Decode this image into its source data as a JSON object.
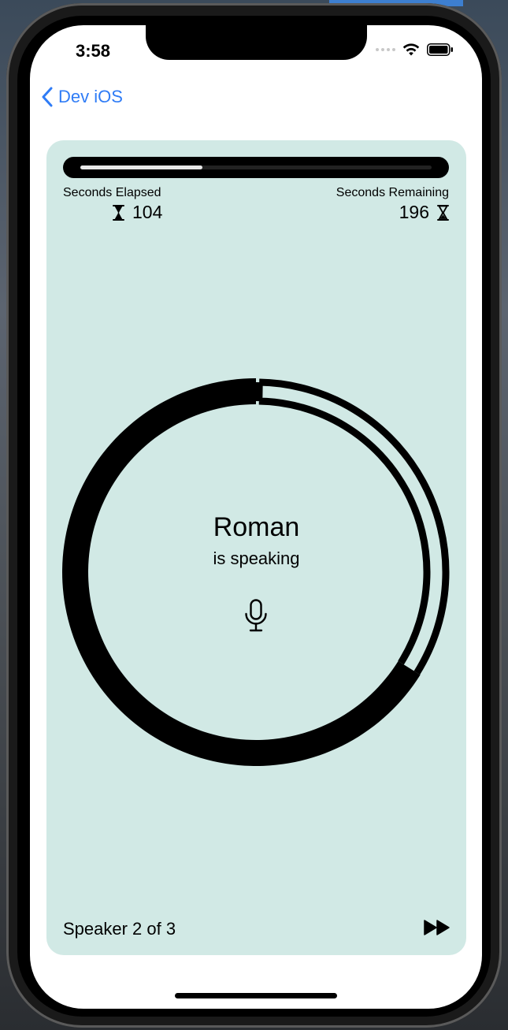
{
  "status_bar": {
    "time": "3:58",
    "icons": [
      "cellular-dots-icon",
      "wifi-icon",
      "battery-icon"
    ]
  },
  "nav": {
    "back_label": "Dev iOS",
    "back_icon": "chevron-left-icon",
    "accent_color": "#2f7cf6"
  },
  "meeting": {
    "card_color": "#d1e9e5",
    "progress_fraction": 0.347,
    "elapsed_label": "Seconds Elapsed",
    "elapsed_value": "104",
    "remaining_label": "Seconds Remaining",
    "remaining_value": "196",
    "elapsed_icon": "hourglass-top-icon",
    "remaining_icon": "hourglass-bottom-icon",
    "speaker_name": "Roman",
    "speaker_status": "is speaking",
    "mic_icon": "mic-icon",
    "speaker_counter": "Speaker 2 of 3",
    "skip_icon": "forward-icon",
    "speaker_segments": 3,
    "speakers_completed_fraction": 0.333
  }
}
